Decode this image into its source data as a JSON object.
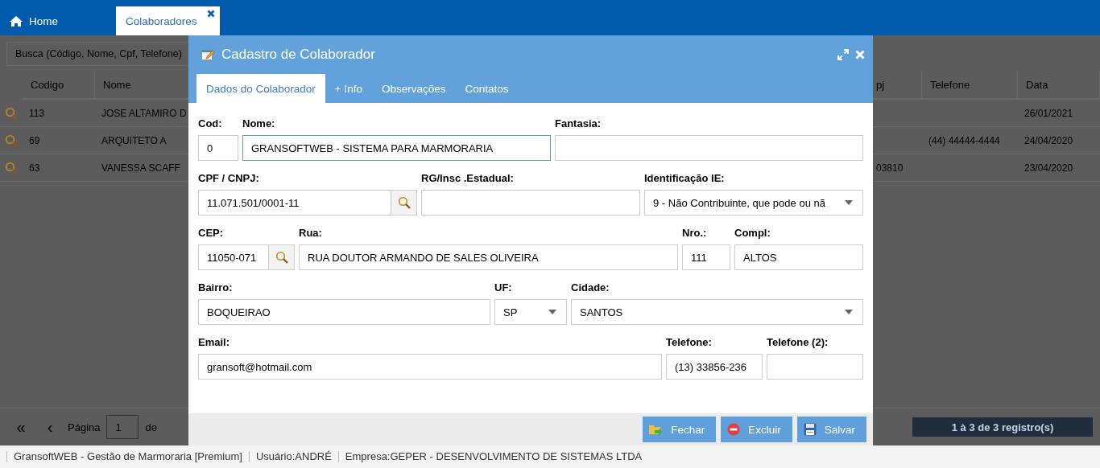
{
  "topbar": {
    "tabs": [
      {
        "label": "Home",
        "kind": "home",
        "selected": false
      },
      {
        "label": "Colaboradores",
        "kind": "closable",
        "selected": true
      }
    ]
  },
  "list": {
    "search": {
      "placeholder": "Busca (Código, Nome, Cpf, Telefone)"
    },
    "table": {
      "columns": [
        "Codigo",
        "Nome",
        "pj",
        "Telefone",
        "Data"
      ],
      "rows": [
        {
          "cells": [
            "113",
            "JOSE ALTAMIRO D",
            null,
            null,
            "26/01/2021"
          ]
        },
        {
          "cells": [
            "69",
            "ARQUITETO A",
            null,
            "(44) 44444-4444",
            "24/04/2020"
          ]
        },
        {
          "cells": [
            "63",
            "VANESSA SCAFF",
            "03810",
            null,
            "23/04/2020"
          ]
        }
      ]
    },
    "pager": {
      "first": "«",
      "previous": "‹",
      "page_label": "Página",
      "page": "1",
      "of_label": "de",
      "summary": "1 à 3 de 3 registro(s)"
    }
  },
  "modal": {
    "title": "Cadastro de Colaborador",
    "tabs": [
      {
        "label": "Dados do Colaborador",
        "selected": true
      },
      {
        "label": "+ Info",
        "selected": false
      },
      {
        "label": "Observações",
        "selected": false
      },
      {
        "label": "Contatos",
        "selected": false
      }
    ],
    "rows": [
      {
        "fields": [
          {
            "label": "Cod:",
            "value": "0",
            "kind": "text",
            "focused": false
          },
          {
            "label": "Nome:",
            "value": "GRANSOFTWEB - SISTEMA PARA MARMORARIA",
            "kind": "text",
            "focused": true
          },
          {
            "label": "Fantasia:",
            "kind": "text",
            "focused": false
          }
        ]
      },
      {
        "fields": [
          {
            "label": "CPF / CNPJ:",
            "value": "11.071.501/0001-11",
            "kind": "lookup",
            "focused": false
          },
          {
            "label": "RG/Insc .Estadual:",
            "kind": "text",
            "focused": false
          },
          {
            "label": "Identificação IE:",
            "value": "9 - Não Contribuinte, que pode ou nã",
            "kind": "select",
            "focused": false
          }
        ]
      },
      {
        "fields": [
          {
            "label": "CEP:",
            "value": "11050-071",
            "kind": "lookup",
            "focused": false
          },
          {
            "label": "Rua:",
            "value": "RUA DOUTOR ARMANDO DE SALES OLIVEIRA",
            "kind": "text",
            "focused": false
          },
          {
            "label": "Nro.:",
            "value": "111",
            "kind": "text",
            "focused": false
          },
          {
            "label": "Compl:",
            "value": "ALTOS",
            "kind": "text",
            "focused": false
          }
        ]
      },
      {
        "fields": [
          {
            "label": "Bairro:",
            "value": "BOQUEIRAO",
            "kind": "text",
            "focused": false
          },
          {
            "label": "UF:",
            "value": "SP",
            "kind": "select",
            "focused": false
          },
          {
            "label": "Cidade:",
            "value": "SANTOS",
            "kind": "select",
            "focused": false
          }
        ]
      },
      {
        "fields": [
          {
            "label": "Email:",
            "value": "gransoft@hotmail.com",
            "kind": "text",
            "focused": false
          },
          {
            "label": "Telefone:",
            "value": "(13) 33856-236",
            "kind": "text",
            "focused": false
          },
          {
            "label": "Telefone (2):",
            "kind": "text",
            "focused": false
          }
        ]
      }
    ],
    "buttons": [
      {
        "label": "Fechar",
        "kind": "close"
      },
      {
        "label": "Excluir",
        "kind": "delete"
      },
      {
        "label": "Salvar",
        "kind": "save"
      }
    ]
  },
  "status_bar": {
    "items": [
      "GransoftWEB - Gestão de Marmoraria [Premium]",
      "Usuário:ANDRÉ",
      "Empresa:GEPER - DESENVOLVIMENTO DE SISTEMAS LTDA"
    ]
  }
}
